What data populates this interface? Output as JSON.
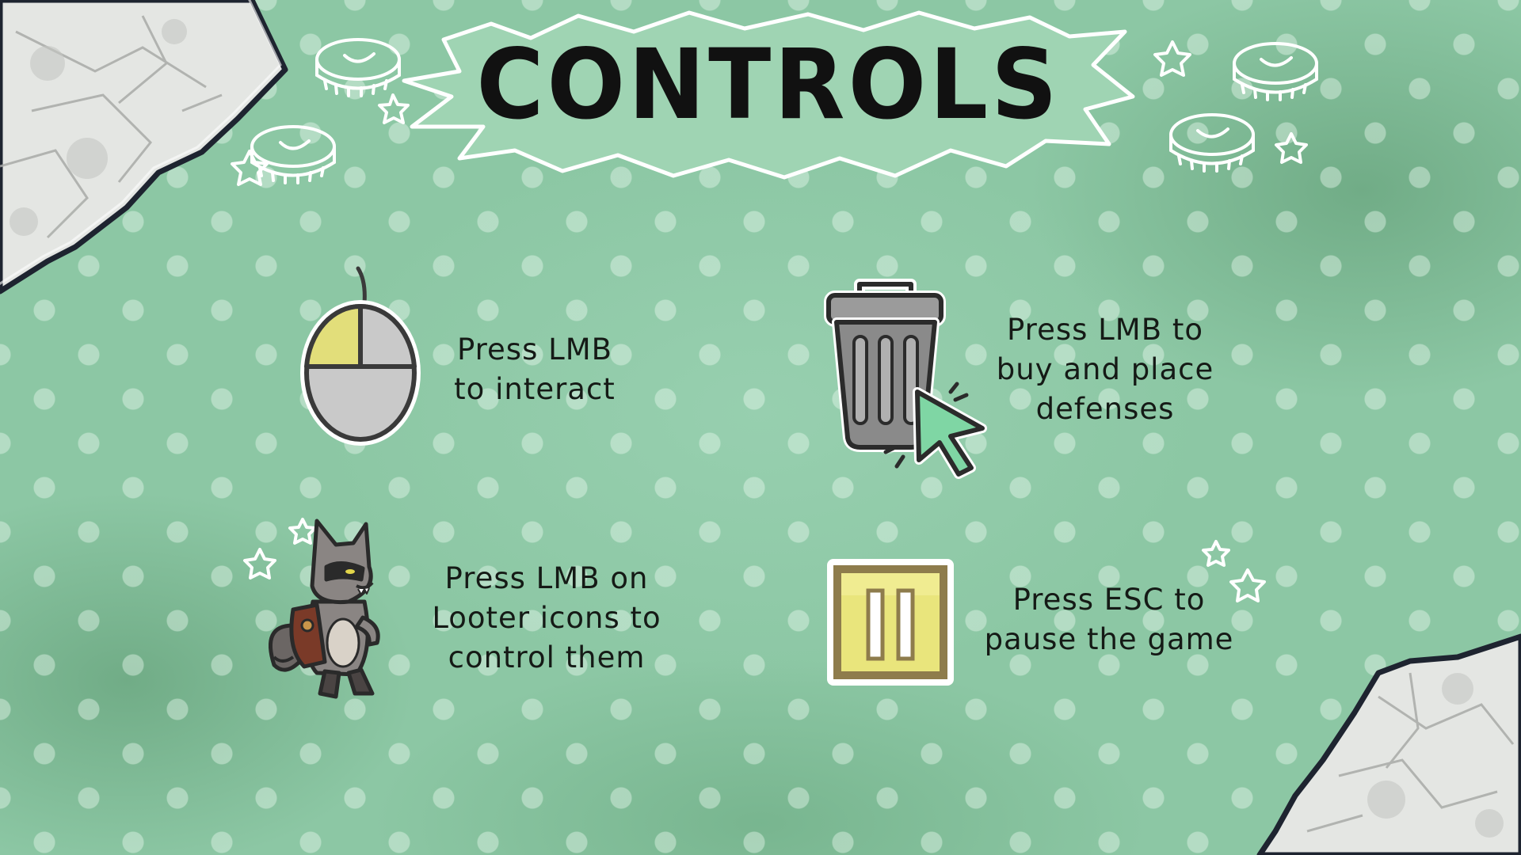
{
  "screen": {
    "title": "CONTROLS"
  },
  "controls": [
    {
      "id": "interact",
      "icon": "mouse-icon",
      "lines": [
        "Press LMB",
        "to interact"
      ]
    },
    {
      "id": "buy-place",
      "icon": "trash-can-cursor-icon",
      "lines": [
        "Press LMB to",
        "buy and place",
        "defenses"
      ]
    },
    {
      "id": "control-looters",
      "icon": "raccoon-looter-icon",
      "lines": [
        "Press LMB on",
        "Looter icons to",
        "control them"
      ]
    },
    {
      "id": "pause",
      "icon": "pause-icon",
      "lines": [
        "Press ESC to",
        "pause the game"
      ]
    }
  ],
  "colors": {
    "background": "#8cc7a4",
    "accent_yellow": "#e6e27a",
    "cursor_green": "#7fd6a4",
    "outline": "#2a2a2a"
  }
}
